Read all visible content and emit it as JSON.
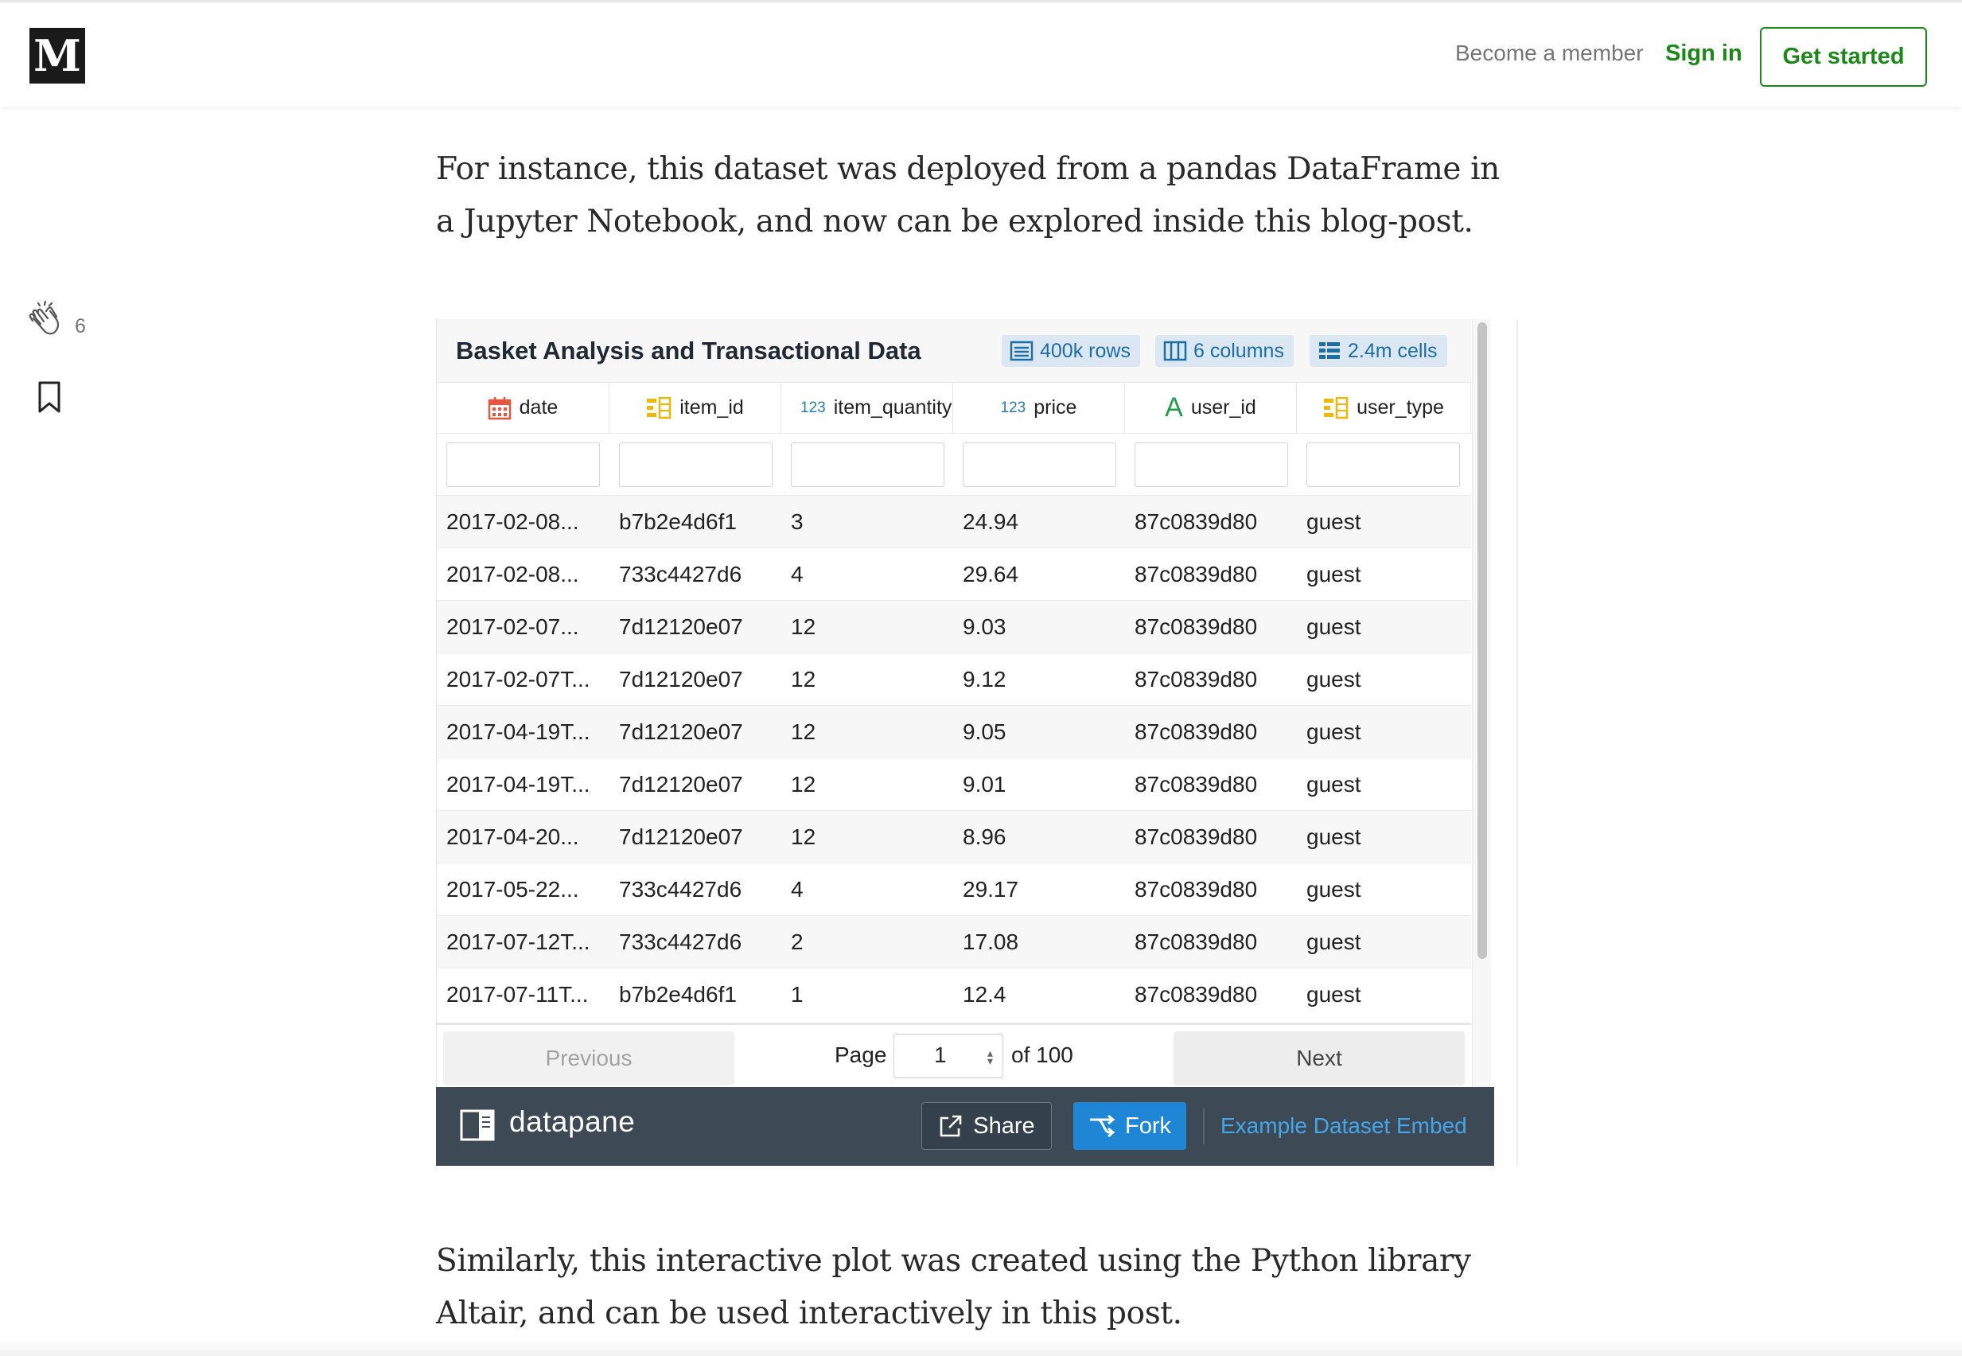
{
  "nav": {
    "logo": "M",
    "become_member": "Become a member",
    "sign_in": "Sign in",
    "get_started": "Get started"
  },
  "rail": {
    "clap_count": "6"
  },
  "article": {
    "para1": "For instance, this dataset was deployed from a pandas DataFrame in a Jupyter Notebook, and now can be explored inside this blog-post.",
    "para2": "Similarly, this interactive plot was created using the Python library Altair, and can be used interactively in this post."
  },
  "embed": {
    "title": "Basket Analysis and Transactional Data",
    "rows_badge": "400k rows",
    "columns_badge": "6 columns",
    "cells_badge": "2.4m cells",
    "columns": [
      {
        "label": "date",
        "icon": "calendar-icon",
        "glyph": ""
      },
      {
        "label": "item_id",
        "icon": "categorical-icon",
        "glyph": ""
      },
      {
        "label": "item_quantity",
        "icon": "numeric-icon",
        "glyph": "123"
      },
      {
        "label": "price",
        "icon": "numeric-icon",
        "glyph": "123"
      },
      {
        "label": "user_id",
        "icon": "text-icon",
        "glyph": "A"
      },
      {
        "label": "user_type",
        "icon": "categorical-icon",
        "glyph": ""
      }
    ],
    "rows": [
      [
        "2017-02-08...",
        "b7b2e4d6f1",
        "3",
        "24.94",
        "87c0839d80",
        "guest"
      ],
      [
        "2017-02-08...",
        "733c4427d6",
        "4",
        "29.64",
        "87c0839d80",
        "guest"
      ],
      [
        "2017-02-07...",
        "7d12120e07",
        "12",
        "9.03",
        "87c0839d80",
        "guest"
      ],
      [
        "2017-02-07T...",
        "7d12120e07",
        "12",
        "9.12",
        "87c0839d80",
        "guest"
      ],
      [
        "2017-04-19T...",
        "7d12120e07",
        "12",
        "9.05",
        "87c0839d80",
        "guest"
      ],
      [
        "2017-04-19T...",
        "7d12120e07",
        "12",
        "9.01",
        "87c0839d80",
        "guest"
      ],
      [
        "2017-04-20...",
        "7d12120e07",
        "12",
        "8.96",
        "87c0839d80",
        "guest"
      ],
      [
        "2017-05-22...",
        "733c4427d6",
        "4",
        "29.17",
        "87c0839d80",
        "guest"
      ],
      [
        "2017-07-12T...",
        "733c4427d6",
        "2",
        "17.08",
        "87c0839d80",
        "guest"
      ],
      [
        "2017-07-11T...",
        "b7b2e4d6f1",
        "1",
        "12.4",
        "87c0839d80",
        "guest"
      ]
    ],
    "pager": {
      "previous": "Previous",
      "page_label": "Page",
      "page_value": "1",
      "of_label": "of 100",
      "next": "Next"
    },
    "footer": {
      "brand": "datapane",
      "share": "Share",
      "fork": "Fork",
      "embed_link": "Example Dataset Embed"
    }
  },
  "colors": {
    "medium_green": "#1a8917",
    "datapane_footer": "#3d4a56",
    "fork_blue": "#1f86d6",
    "link_blue": "#44a6e8"
  }
}
